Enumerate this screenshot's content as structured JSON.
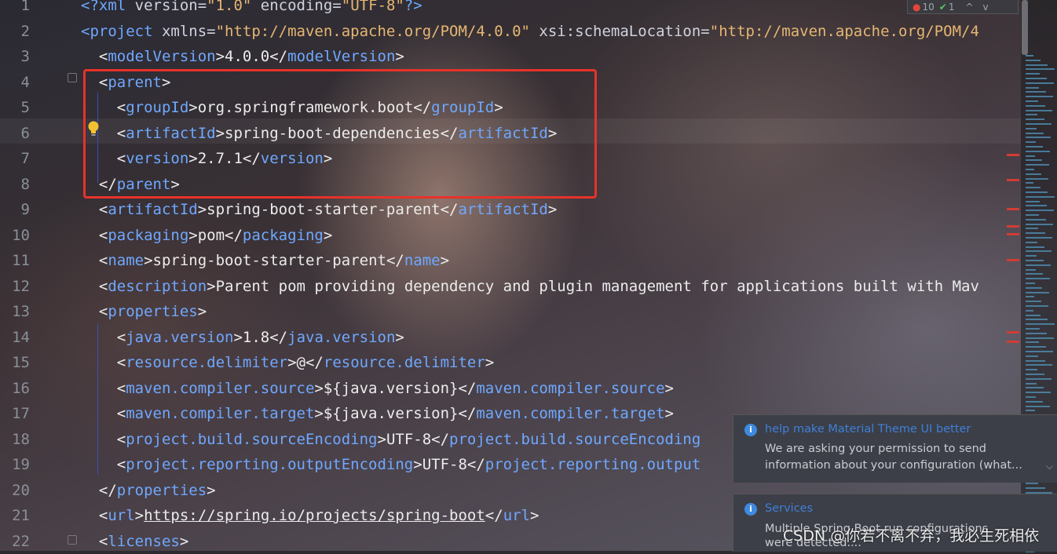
{
  "editor": {
    "lines": [
      {
        "n": "1",
        "parts": [
          {
            "c": "t",
            "x": "<?xml "
          },
          {
            "c": "a",
            "x": "version="
          },
          {
            "c": "s",
            "x": "\"1.0\""
          },
          {
            "c": "a",
            "x": " encoding="
          },
          {
            "c": "s",
            "x": "\"UTF-8\""
          },
          {
            "c": "t",
            "x": "?>"
          }
        ]
      },
      {
        "n": "2",
        "parts": [
          {
            "c": "t",
            "x": "<project "
          },
          {
            "c": "a",
            "x": "xmlns="
          },
          {
            "c": "s",
            "x": "\"http://maven.apache.org/POM/4.0.0\""
          },
          {
            "c": "a",
            "x": " xsi:schemaLocation="
          },
          {
            "c": "s",
            "x": "\"http://maven.apache.org/POM/4"
          }
        ]
      },
      {
        "n": "3",
        "parts": [
          {
            "c": "v",
            "x": "  <"
          },
          {
            "c": "t",
            "x": "modelVersion"
          },
          {
            "c": "v",
            "x": ">4.0.0</"
          },
          {
            "c": "t",
            "x": "modelVersion"
          },
          {
            "c": "v",
            "x": ">"
          }
        ]
      },
      {
        "n": "4",
        "parts": [
          {
            "c": "v",
            "x": "  <"
          },
          {
            "c": "t",
            "x": "parent"
          },
          {
            "c": "v",
            "x": ">"
          }
        ]
      },
      {
        "n": "5",
        "parts": [
          {
            "c": "v",
            "x": "    <"
          },
          {
            "c": "t",
            "x": "groupId"
          },
          {
            "c": "v",
            "x": ">org.springframework.boot</"
          },
          {
            "c": "t",
            "x": "groupId"
          },
          {
            "c": "v",
            "x": ">"
          }
        ]
      },
      {
        "n": "6",
        "parts": [
          {
            "c": "v",
            "x": "    <"
          },
          {
            "c": "t",
            "x": "artifactId"
          },
          {
            "c": "v",
            "x": ">spring-boot-dependencies</"
          },
          {
            "c": "t",
            "x": "artifactId"
          },
          {
            "c": "v",
            "x": ">"
          }
        ]
      },
      {
        "n": "7",
        "parts": [
          {
            "c": "v",
            "x": "    <"
          },
          {
            "c": "t",
            "x": "version"
          },
          {
            "c": "v",
            "x": ">2.7.1</"
          },
          {
            "c": "t",
            "x": "version"
          },
          {
            "c": "v",
            "x": ">"
          }
        ]
      },
      {
        "n": "8",
        "parts": [
          {
            "c": "v",
            "x": "  </"
          },
          {
            "c": "t",
            "x": "parent"
          },
          {
            "c": "v",
            "x": ">"
          }
        ]
      },
      {
        "n": "9",
        "parts": [
          {
            "c": "v",
            "x": "  <"
          },
          {
            "c": "t",
            "x": "artifactId"
          },
          {
            "c": "v",
            "x": ">spring-boot-starter-parent</"
          },
          {
            "c": "t",
            "x": "artifactId"
          },
          {
            "c": "v",
            "x": ">"
          }
        ]
      },
      {
        "n": "10",
        "parts": [
          {
            "c": "v",
            "x": "  <"
          },
          {
            "c": "t",
            "x": "packaging"
          },
          {
            "c": "v",
            "x": ">pom</"
          },
          {
            "c": "t",
            "x": "packaging"
          },
          {
            "c": "v",
            "x": ">"
          }
        ]
      },
      {
        "n": "11",
        "parts": [
          {
            "c": "v",
            "x": "  <"
          },
          {
            "c": "t",
            "x": "name"
          },
          {
            "c": "v",
            "x": ">spring-boot-starter-parent</"
          },
          {
            "c": "t",
            "x": "name"
          },
          {
            "c": "v",
            "x": ">"
          }
        ]
      },
      {
        "n": "12",
        "parts": [
          {
            "c": "v",
            "x": "  <"
          },
          {
            "c": "t",
            "x": "description"
          },
          {
            "c": "v",
            "x": ">Parent pom providing dependency and plugin management for applications built with Mav"
          }
        ]
      },
      {
        "n": "13",
        "parts": [
          {
            "c": "v",
            "x": "  <"
          },
          {
            "c": "t",
            "x": "properties"
          },
          {
            "c": "v",
            "x": ">"
          }
        ]
      },
      {
        "n": "14",
        "parts": [
          {
            "c": "v",
            "x": "    <"
          },
          {
            "c": "t",
            "x": "java.version"
          },
          {
            "c": "v",
            "x": ">1.8</"
          },
          {
            "c": "t",
            "x": "java.version"
          },
          {
            "c": "v",
            "x": ">"
          }
        ]
      },
      {
        "n": "15",
        "parts": [
          {
            "c": "v",
            "x": "    <"
          },
          {
            "c": "t",
            "x": "resource.delimiter"
          },
          {
            "c": "v",
            "x": ">@</"
          },
          {
            "c": "t",
            "x": "resource.delimiter"
          },
          {
            "c": "v",
            "x": ">"
          }
        ]
      },
      {
        "n": "16",
        "parts": [
          {
            "c": "v",
            "x": "    <"
          },
          {
            "c": "t",
            "x": "maven.compiler.source"
          },
          {
            "c": "v",
            "x": ">${java.version}</"
          },
          {
            "c": "t",
            "x": "maven.compiler.source"
          },
          {
            "c": "v",
            "x": ">"
          }
        ]
      },
      {
        "n": "17",
        "parts": [
          {
            "c": "v",
            "x": "    <"
          },
          {
            "c": "t",
            "x": "maven.compiler.target"
          },
          {
            "c": "v",
            "x": ">${java.version}</"
          },
          {
            "c": "t",
            "x": "maven.compiler.target"
          },
          {
            "c": "v",
            "x": ">"
          }
        ]
      },
      {
        "n": "18",
        "parts": [
          {
            "c": "v",
            "x": "    <"
          },
          {
            "c": "t",
            "x": "project.build.sourceEncoding"
          },
          {
            "c": "v",
            "x": ">UTF-8</"
          },
          {
            "c": "t",
            "x": "project.build.sourceEncoding"
          }
        ]
      },
      {
        "n": "19",
        "parts": [
          {
            "c": "v",
            "x": "    <"
          },
          {
            "c": "t",
            "x": "project.reporting.outputEncoding"
          },
          {
            "c": "v",
            "x": ">UTF-8</"
          },
          {
            "c": "t",
            "x": "project.reporting.output"
          }
        ]
      },
      {
        "n": "20",
        "parts": [
          {
            "c": "v",
            "x": "  </"
          },
          {
            "c": "t",
            "x": "properties"
          },
          {
            "c": "v",
            "x": ">"
          }
        ]
      },
      {
        "n": "21",
        "parts": [
          {
            "c": "v",
            "x": "  <"
          },
          {
            "c": "t",
            "x": "url"
          },
          {
            "c": "v",
            "x": ">"
          },
          {
            "c": "u",
            "x": "https://spring.io/projects/spring-boot"
          },
          {
            "c": "v",
            "x": "</"
          },
          {
            "c": "t",
            "x": "url"
          },
          {
            "c": "v",
            "x": ">"
          }
        ]
      },
      {
        "n": "22",
        "parts": [
          {
            "c": "v",
            "x": "  <"
          },
          {
            "c": "t",
            "x": "licenses"
          },
          {
            "c": "v",
            "x": ">"
          }
        ]
      }
    ]
  },
  "inspection": {
    "errors": "10",
    "ok": "1",
    "up": "^",
    "down": "v"
  },
  "notifications": [
    {
      "title": "help make Material Theme UI better",
      "body1": "We are asking your permission to send",
      "body2": "information about your configuration (what..."
    },
    {
      "title": "Services",
      "body1": "Multiple Spring Boot run configurations",
      "body2": "were detected...."
    }
  ],
  "watermark": "CSDN @你若不离不弃，我必生死相依",
  "colors": {
    "tag": "#6fa8ff",
    "string": "#e6b673",
    "highlight_box": "#e8322a",
    "error": "#e0463a"
  },
  "icons": {
    "bulb": "lightbulb-icon",
    "info": "info-icon",
    "error": "error-icon",
    "check": "check-icon"
  }
}
